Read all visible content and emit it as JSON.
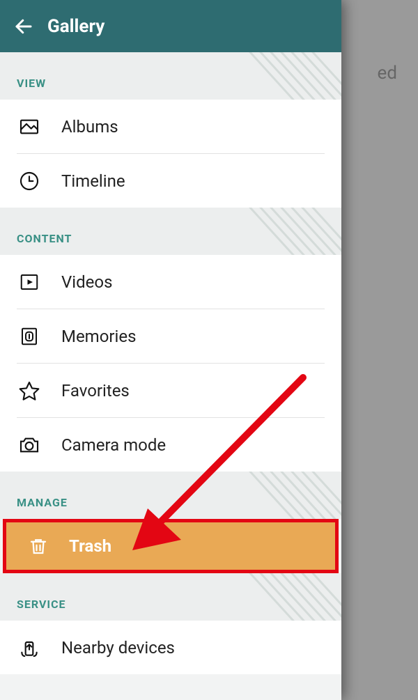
{
  "backdrop": {
    "partial_text": "ed"
  },
  "header": {
    "title": "Gallery"
  },
  "sections": {
    "view": {
      "label": "VIEW",
      "items": [
        {
          "label": "Albums",
          "icon": "image-icon"
        },
        {
          "label": "Timeline",
          "icon": "clock-icon"
        }
      ]
    },
    "content": {
      "label": "CONTENT",
      "items": [
        {
          "label": "Videos",
          "icon": "play-icon"
        },
        {
          "label": "Memories",
          "icon": "memories-icon"
        },
        {
          "label": "Favorites",
          "icon": "star-icon"
        },
        {
          "label": "Camera mode",
          "icon": "camera-icon"
        }
      ]
    },
    "manage": {
      "label": "MANAGE",
      "items": [
        {
          "label": "Trash",
          "icon": "trash-icon"
        }
      ]
    },
    "service": {
      "label": "SERVICE",
      "items": [
        {
          "label": "Nearby devices",
          "icon": "nearby-icon"
        }
      ]
    }
  },
  "annotation": {
    "highlight_color": "#e30613",
    "arrow_color": "#e30613"
  }
}
